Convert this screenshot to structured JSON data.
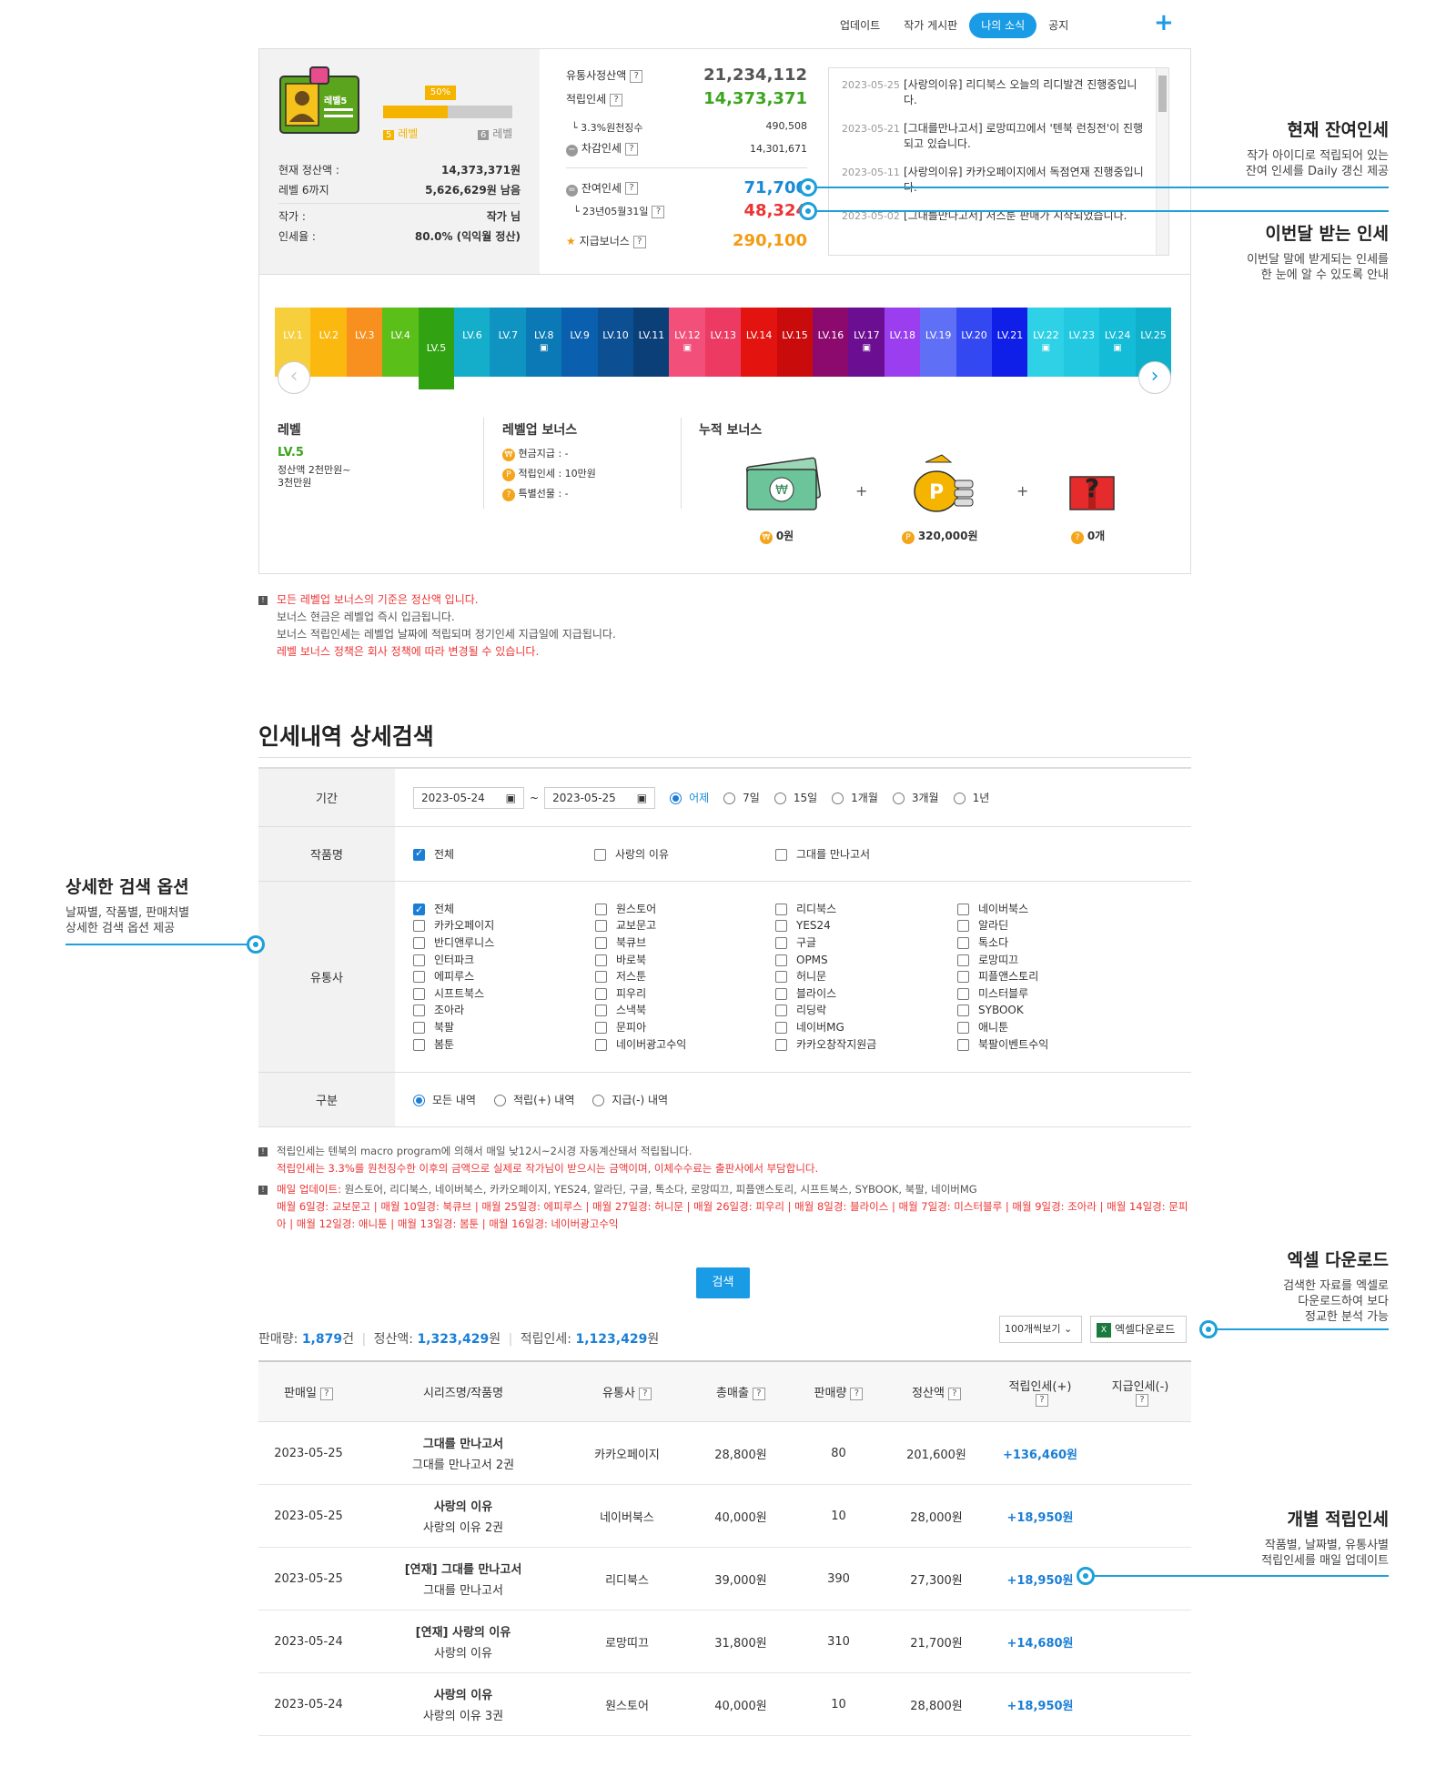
{
  "nav": {
    "items": [
      "업데이트",
      "작가 게시판",
      "나의 소식",
      "공지"
    ],
    "plus": "+"
  },
  "profile": {
    "badge_label": "레벨5",
    "progress": {
      "percent_label": "50%",
      "fill": 0.5
    },
    "cur_level_num": "5",
    "cur_level_word": "레벨",
    "next_level_num": "6",
    "next_level_word": "레벨",
    "rows": [
      {
        "label": "현재 정산액 :",
        "value": "14,373,371원"
      },
      {
        "label": "레벨 6까지",
        "value": "5,626,629원 남음"
      },
      {
        "label": "작가 :",
        "value": "작가 님"
      },
      {
        "label": "인세율 :",
        "value": "80.0% (익익월 정산)"
      }
    ]
  },
  "summary": {
    "rows": [
      {
        "label": "유통사정산액",
        "value": "21,234,112"
      },
      {
        "label": "적립인세",
        "value": "14,373,371"
      },
      {
        "label": "3.3%원천징수",
        "value": "490,508"
      },
      {
        "label": "차감인세",
        "value": "14,301,671"
      },
      {
        "label": "잔여인세",
        "value": "71,700"
      },
      {
        "label": "23년05월31일",
        "value": "48,324"
      },
      {
        "label": "지급보너스",
        "value": "290,100"
      }
    ]
  },
  "notices": [
    {
      "date": "2023-05-25",
      "text": "[사랑의이유] 리디북스 오늘의 리디발견 진행중입니다."
    },
    {
      "date": "2023-05-21",
      "text": "[그대를만나고서] 로망띠끄에서 '텐북 런칭전'이 진행되고 있습니다."
    },
    {
      "date": "2023-05-11",
      "text": "[사랑의이유] 카카오페이지에서 독점연재 진행중입니다."
    },
    {
      "date": "2023-05-02",
      "text": "[그대를만나고서] 저스툰 판매가 시작되었습니다."
    }
  ],
  "levels": [
    {
      "label": "LV.1",
      "color": "#f7cf3d",
      "gift": false
    },
    {
      "label": "LV.2",
      "color": "#fbb80f",
      "gift": false
    },
    {
      "label": "LV.3",
      "color": "#f7901e",
      "gift": false
    },
    {
      "label": "LV.4",
      "color": "#5bbf1a",
      "gift": false
    },
    {
      "label": "LV.5",
      "color": "#31a313",
      "gift": false
    },
    {
      "label": "LV.6",
      "color": "#14aecb",
      "gift": false
    },
    {
      "label": "LV.7",
      "color": "#0f94c1",
      "gift": false
    },
    {
      "label": "LV.8",
      "color": "#0a79b5",
      "gift": true
    },
    {
      "label": "LV.9",
      "color": "#0a5fae",
      "gift": false
    },
    {
      "label": "LV.10",
      "color": "#0c4f93",
      "gift": false
    },
    {
      "label": "LV.11",
      "color": "#0a3f78",
      "gift": false
    },
    {
      "label": "LV.12",
      "color": "#f24f7a",
      "gift": true
    },
    {
      "label": "LV.13",
      "color": "#ed3a63",
      "gift": false
    },
    {
      "label": "LV.14",
      "color": "#e3140f",
      "gift": false
    },
    {
      "label": "LV.15",
      "color": "#c90b0b",
      "gift": false
    },
    {
      "label": "LV.16",
      "color": "#8c0a6e",
      "gift": false
    },
    {
      "label": "LV.17",
      "color": "#6b0e91",
      "gift": true
    },
    {
      "label": "LV.18",
      "color": "#9b3ef0",
      "gift": false
    },
    {
      "label": "LV.19",
      "color": "#5f6ff6",
      "gift": false
    },
    {
      "label": "LV.20",
      "color": "#3448f2",
      "gift": false
    },
    {
      "label": "LV.21",
      "color": "#0f1fe8",
      "gift": false
    },
    {
      "label": "LV.22",
      "color": "#2fd1e6",
      "gift": true
    },
    {
      "label": "LV.23",
      "color": "#21c8e0",
      "gift": false
    },
    {
      "label": "LV.24",
      "color": "#14bcd7",
      "gift": true
    },
    {
      "label": "LV.25",
      "color": "#0fb0cc",
      "gift": false
    }
  ],
  "level_info": {
    "title": "레벨",
    "level": "LV.5",
    "desc1": "정산액 2천만원~",
    "desc2": "3천만원",
    "bonus_title": "레벨업 보너스",
    "bonus_items": [
      "현금지급 : -",
      "적립인세 : 10만원",
      "특별선물 : -"
    ],
    "cum_title": "누적 보너스",
    "cum_values": [
      "0원",
      "320,000원",
      "0개"
    ],
    "plus": "+"
  },
  "notes1": [
    "모든 레벨업 보너스의 기준은 정산액 입니다.",
    "보너스 현금은 레벨업 즉시 입금됩니다.",
    "보너스 적립인세는 레벨업 날짜에 적립되며 정기인세 지급일에 지급됩니다.",
    "레벨 보너스 정책은 회사 정책에 따라 변경될 수 있습니다."
  ],
  "search": {
    "title": "인세내역 상세검색",
    "period_label": "기간",
    "date_from": "2023-05-24",
    "date_to": "2023-05-25",
    "tilde": "~",
    "period_options": [
      "어제",
      "7일",
      "15일",
      "1개월",
      "3개월",
      "1년"
    ],
    "works_label": "작품명",
    "works": [
      "전체",
      "사랑의 이유",
      "그대를 만나고서"
    ],
    "dist_label": "유통사",
    "distributors": [
      "전체",
      "원스토어",
      "리디북스",
      "네이버북스",
      "카카오페이지",
      "교보문고",
      "YES24",
      "알라딘",
      "반디앤루니스",
      "북큐브",
      "구글",
      "톡소다",
      "인터파크",
      "바로북",
      "OPMS",
      "로망띠끄",
      "에피루스",
      "저스툰",
      "허니문",
      "피플앤스토리",
      "시프트북스",
      "피우리",
      "블라이스",
      "미스터블루",
      "조아라",
      "스낵북",
      "리딩락",
      "SYBOOK",
      "북팔",
      "문피아",
      "네이버MG",
      "애니툰",
      "봄툰",
      "네이버광고수익",
      "카카오창작지원금",
      "북팔이벤트수익"
    ],
    "type_label": "구분",
    "types": [
      "모든 내역",
      "적립(+) 내역",
      "지급(-) 내역"
    ],
    "button": "검색"
  },
  "notes2": {
    "l1": "적립인세는 텐북의 macro program에 의해서 매일 낮12시~2시경 자동계산돼서 적립됩니다.",
    "l2": "적립인세는 3.3%를 원천징수한 이후의 금액으로 실제로 작가님이 받으시는 금액이며, 이체수수료는 출판사에서 부담합니다.",
    "l3a": "매일 업데이트:",
    "l3b": " 원스토어, 리디북스, 네이버북스, 카카오페이지, YES24, 알라딘, 구글, 톡소다, 로망띠끄, 피플앤스토리, 시프트북스, SYBOOK, 북팔, 네이버MG",
    "l4": "매월 6일경: 교보문고 | 매월 10일경: 북큐브 | 매월 25일경: 에피루스 | 매월 27일경: 허니문 | 매월 26일경: 피우리 | 매월 8일경: 블라이스 | 매월 7일경: 미스터블루 | 매월 9일경: 조아라 | 매월 14일경: 문피아 | 매월 12일경: 애니툰 | 매월 13일경: 봄툰 | 매월 16일경: 네이버광고수익"
  },
  "stats": {
    "sales_label": "판매량:",
    "sales": "1,879",
    "sales_unit": "건",
    "settle_label": "정산액:",
    "settle": "1,323,429",
    "settle_unit": "원",
    "royalty_label": "적립인세:",
    "royalty": "1,123,429",
    "royalty_unit": "원"
  },
  "controls": {
    "per_page": "100개씩보기",
    "excel": "엑셀다운로드"
  },
  "table": {
    "headers": [
      "판매일",
      "시리즈명/작품명",
      "유통사",
      "총매출",
      "판매량",
      "정산액",
      "적립인세(+)",
      "지급인세(-)"
    ],
    "rows": [
      {
        "date": "2023-05-25",
        "series": "그대를 만나고서",
        "title": "그대를 만나고서 2권",
        "dist": "카카오페이지",
        "total": "28,800원",
        "qty": "80",
        "settle": "201,600원",
        "plus": "+136,460원",
        "minus": ""
      },
      {
        "date": "2023-05-25",
        "series": "사랑의 이유",
        "title": "사랑의 이유 2권",
        "dist": "네이버북스",
        "total": "40,000원",
        "qty": "10",
        "settle": "28,000원",
        "plus": "+18,950원",
        "minus": ""
      },
      {
        "date": "2023-05-25",
        "series": "[연재] 그대를 만나고서",
        "title": "그대를 만나고서",
        "dist": "리디북스",
        "total": "39,000원",
        "qty": "390",
        "settle": "27,300원",
        "plus": "+18,950원",
        "minus": ""
      },
      {
        "date": "2023-05-24",
        "series": "[연재] 사랑의 이유",
        "title": "사랑의 이유",
        "dist": "로망띠끄",
        "total": "31,800원",
        "qty": "310",
        "settle": "21,700원",
        "plus": "+14,680원",
        "minus": ""
      },
      {
        "date": "2023-05-24",
        "series": "사랑의 이유",
        "title": "사랑의 이유 3권",
        "dist": "원스토어",
        "total": "40,000원",
        "qty": "10",
        "settle": "28,800원",
        "plus": "+18,950원",
        "minus": ""
      }
    ]
  },
  "callouts": [
    {
      "title": "현재 잔여인세",
      "l1": "작가 아이디로 적립되어 있는",
      "l2": "잔여 인세를 Daily 갱신 제공"
    },
    {
      "title": "이번달 받는 인세",
      "l1": "이번달 말에 받게되는 인세를",
      "l2": "한 눈에 알 수 있도록 안내"
    },
    {
      "title": "상세한 검색 옵션",
      "l1": "날짜별, 작품별, 판매처별",
      "l2": "상세한 검색 옵션 제공"
    },
    {
      "title": "엑셀 다운로드",
      "l1": "검색한 자료를 엑셀로",
      "l2": "다운로드하여 보다",
      "l3": "정교한 분석 가능"
    },
    {
      "title": "개별 적립인세",
      "l1": "작품별, 날짜별, 유통사별",
      "l2": "적립인세를 매일 업데이트"
    }
  ],
  "q": "?"
}
